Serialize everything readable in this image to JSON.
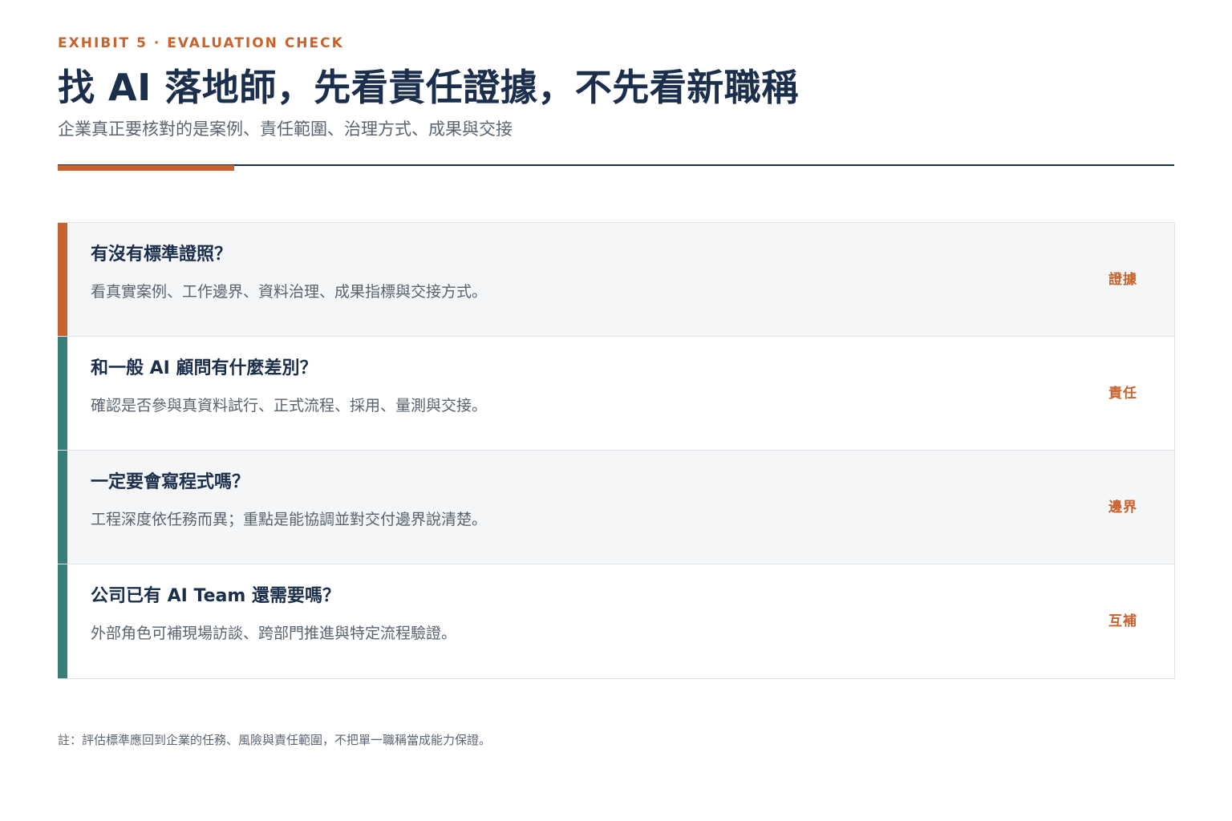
{
  "colors": {
    "accent_orange": "#c8632d",
    "accent_teal": "#3b7d78",
    "navy": "#1b2f4c"
  },
  "header": {
    "eyebrow": "EXHIBIT 5 · EVALUATION CHECK",
    "title": "找 AI 落地師，先看責任證據，不先看新職稱",
    "subtitle": "企業真正要核對的是案例、責任範圍、治理方式、成果與交接"
  },
  "items": [
    {
      "question": "有沒有標準證照？",
      "answer": "看真實案例、工作邊界、資料治理、成果指標與交接方式。",
      "tag": "證據",
      "bar_color": "#c8632d"
    },
    {
      "question": "和一般 AI 顧問有什麼差別？",
      "answer": "確認是否參與真資料試行、正式流程、採用、量測與交接。",
      "tag": "責任",
      "bar_color": "#3b7d78"
    },
    {
      "question": "一定要會寫程式嗎？",
      "answer": "工程深度依任務而異；重點是能協調並對交付邊界說清楚。",
      "tag": "邊界",
      "bar_color": "#3b7d78"
    },
    {
      "question": "公司已有 AI Team 還需要嗎？",
      "answer": "外部角色可補現場訪談、跨部門推進與特定流程驗證。",
      "tag": "互補",
      "bar_color": "#3b7d78"
    }
  ],
  "footnote": "註：評估標準應回到企業的任務、風險與責任範圍，不把單一職稱當成能力保證。"
}
